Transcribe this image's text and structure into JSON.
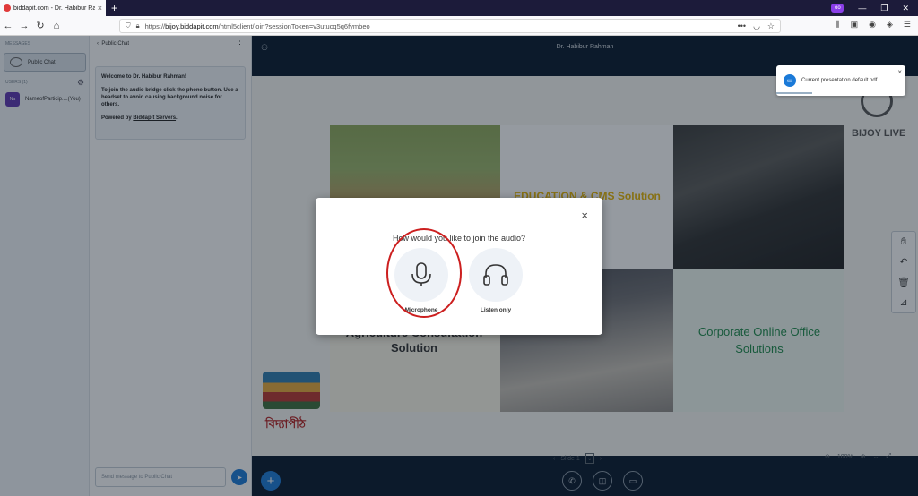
{
  "browser": {
    "tab_title": "biddapit.com - Dr. Habibur Ra",
    "tab_close": "×",
    "new_tab": "+",
    "url_host": "bijoy.biddapit.com",
    "url_path": "/html5client/join?sessionToken=v3utucq5q6fymbeo",
    "url_prefix": "https://",
    "url_dots": "•••",
    "window_min": "—",
    "window_max": "❐",
    "window_close": "✕"
  },
  "sidebar": {
    "messages_label": "MESSAGES",
    "public_chat": "Public Chat",
    "users_label": "USERS (1)",
    "user_initials": "Na",
    "user_name": "NameofParticip....(You)"
  },
  "chat": {
    "header": "Public Chat",
    "welcome_title": "Welcome to Dr. Habibur Rahman!",
    "welcome_body": "To join the audio bridge click the phone button. Use a headset to avoid causing background noise for others.",
    "powered_prefix": "Powered by ",
    "powered_link": "Biddapit Servers",
    "powered_suffix": ".",
    "input_placeholder": "Send message to Public Chat"
  },
  "presentation": {
    "presenter_name": "Dr. Habibur Rahman",
    "slide_label": "Slide 1",
    "zoom": "100%",
    "text_edu": "EDUCATION & CMS Solution",
    "text_agri": "Agriculture Consultation Solution",
    "text_corp": "Corporate Online Office Solutions",
    "brand_name": "BIJOY LIVE",
    "bidya_name": "বিদ্যাপীঠ"
  },
  "toast": {
    "message": "Current presentation default.pdf",
    "close": "×"
  },
  "modal": {
    "question": "How would you like to join the audio?",
    "close": "×",
    "microphone_label": "Microphone",
    "listen_label": "Listen only"
  },
  "colors": {
    "accent": "#1b7ad8",
    "header_bg": "#06172a",
    "annotation": "#cc1f1f"
  }
}
